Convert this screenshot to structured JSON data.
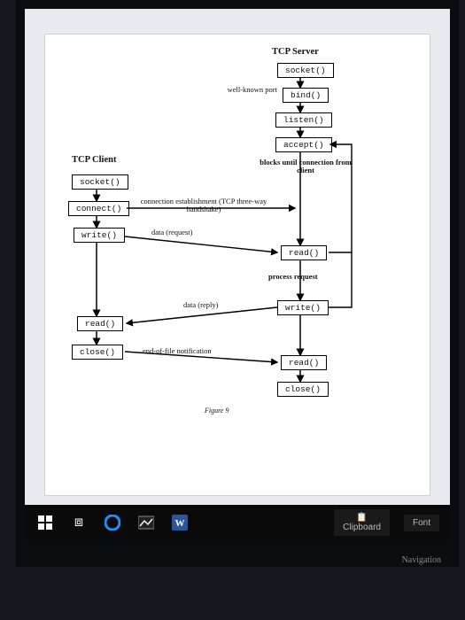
{
  "diagram": {
    "title_server": "TCP Server",
    "title_client": "TCP Client",
    "server_boxes": {
      "socket": "socket()",
      "bind": "bind()",
      "listen": "listen()",
      "accept": "accept()",
      "read1": "read()",
      "write": "write()",
      "read2": "read()",
      "close": "close()"
    },
    "client_boxes": {
      "socket": "socket()",
      "connect": "connect()",
      "write": "write()",
      "read": "read()",
      "close": "close()"
    },
    "annot": {
      "wellknown": "well-known port",
      "blocks": "blocks until connection from client",
      "conn_est": "connection establishment (TCP three-way handshake)",
      "data_req": "data (request)",
      "process": "process request",
      "data_reply": "data (reply)",
      "eof": "end-of-file notification"
    },
    "caption": "Figure 9"
  },
  "taskbar": {
    "clipboard": "Clipboard",
    "font": "Font",
    "navigation": "Navigation"
  }
}
